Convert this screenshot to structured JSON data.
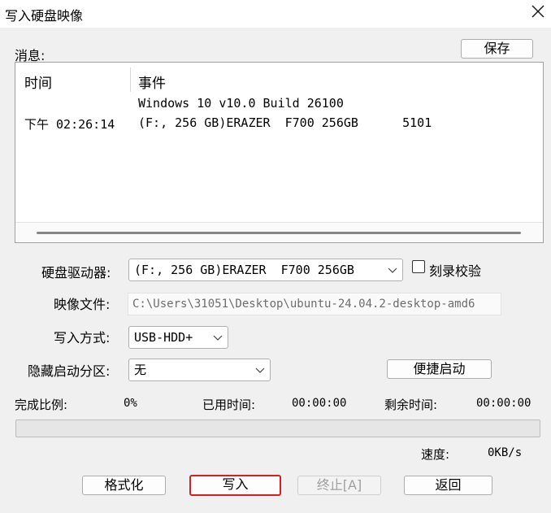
{
  "window": {
    "title": "写入硬盘映像"
  },
  "messages": {
    "label": "消息:",
    "save_label": "保存",
    "columns": [
      "时间",
      "事件"
    ],
    "rows": [
      {
        "time": "",
        "event": "Windows 10 v10.0 Build 26100"
      },
      {
        "time": "下午 02:26:14",
        "event": "(F:, 256 GB)ERAZER  F700 256GB      5101"
      }
    ]
  },
  "form": {
    "drive_label": "硬盘驱动器:",
    "drive_value": "(F:, 256 GB)ERAZER  F700 256GB",
    "verify_label": "刻录校验",
    "verify_checked": false,
    "image_label": "映像文件:",
    "image_value": "C:\\Users\\31051\\Desktop\\ubuntu-24.04.2-desktop-amd6",
    "method_label": "写入方式:",
    "method_value": "USB-HDD+",
    "hidden_label": "隐藏启动分区:",
    "hidden_value": "无",
    "quick_boot_label": "便捷启动"
  },
  "status": {
    "progress_label": "完成比例:",
    "progress_value": "0%",
    "progress_fraction": 0,
    "elapsed_label": "已用时间:",
    "elapsed_value": "00:00:00",
    "remaining_label": "剩余时间:",
    "remaining_value": "00:00:00",
    "speed_label": "速度:",
    "speed_value": "0KB/s"
  },
  "buttons": {
    "format_label": "格式化",
    "write_label": "写入",
    "stop_label": "终止[A]",
    "back_label": "返回"
  },
  "colors": {
    "progress_fill": "#06b025",
    "focus_border": "#d81e1e"
  }
}
